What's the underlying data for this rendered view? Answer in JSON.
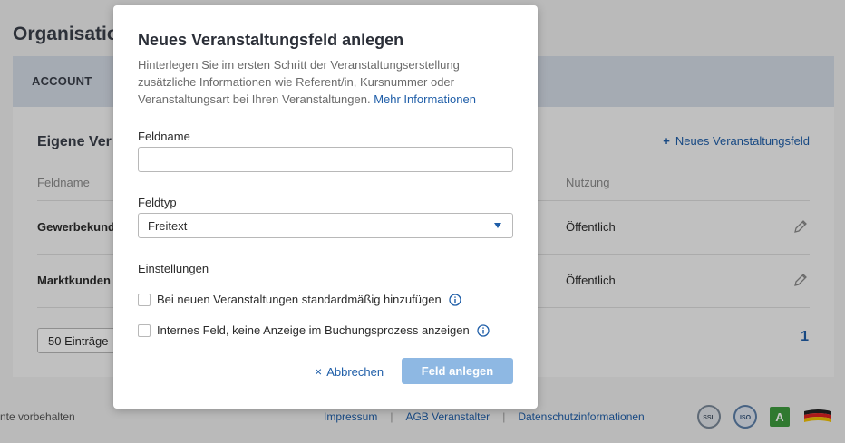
{
  "background": {
    "page_title": "Organisation",
    "tab_account": "ACCOUNT",
    "card_title": "Eigene Ver",
    "add_field_link": "Neues Veranstaltungsfeld",
    "columns": {
      "name": "Feldname",
      "usage": "Nutzung"
    },
    "rows": [
      {
        "name": "Gewerbekund",
        "usage": "Öffentlich"
      },
      {
        "name": "Marktkunden",
        "usage": "Öffentlich"
      }
    ],
    "page_size": "50 Einträge",
    "current_page": "1",
    "footer_left": "nte vorbehalten",
    "footer_links": [
      "Impressum",
      "AGB Veranstalter",
      "Datenschutzinformationen"
    ],
    "badges": {
      "ssl": "SSL",
      "iso": "ISO",
      "grade": "A"
    }
  },
  "modal": {
    "title": "Neues Veranstaltungsfeld anlegen",
    "description": "Hinterlegen Sie im ersten Schritt der Veranstaltungserstellung zusätzliche Informationen wie Referent/in, Kursnummer oder Veranstaltungsart bei Ihren Veranstaltungen.",
    "more_link": "Mehr Informationen",
    "field_name_label": "Feldname",
    "field_name_value": "",
    "field_type_label": "Feldtyp",
    "field_type_value": "Freitext",
    "settings_label": "Einstellungen",
    "checkbox_default": "Bei neuen Veranstaltungen standardmäßig hinzufügen",
    "checkbox_internal": "Internes Feld, keine Anzeige im Buchungsprozess anzeigen",
    "cancel_label": "Abbrechen",
    "submit_label": "Feld anlegen"
  },
  "colors": {
    "accent": "#1f5ea8",
    "button_disabled": "#8eb8e3"
  }
}
